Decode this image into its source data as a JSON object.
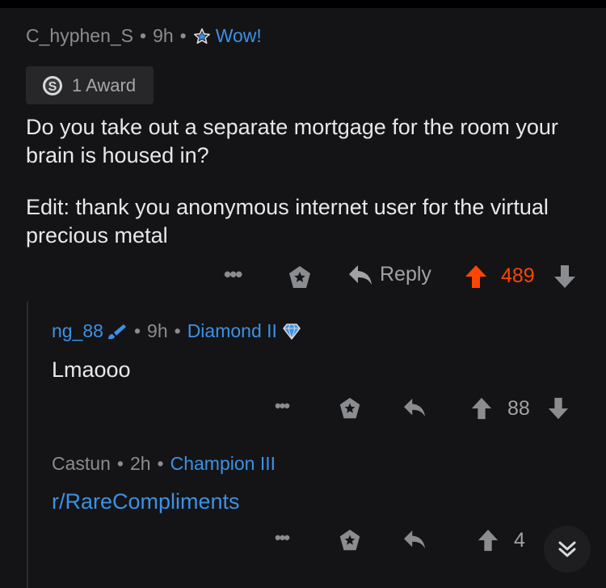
{
  "comments": [
    {
      "author": "C_hyphen_S",
      "time": "9h",
      "flair": "Wow!",
      "award": "1 Award",
      "body": [
        "Do you take out a separate mortgage for the room your brain is housed in?",
        "Edit: thank you anonymous internet user for the virtual precious metal"
      ],
      "reply_label": "Reply",
      "score": "489",
      "upvoted": true
    },
    {
      "author": "ng_88",
      "time": "9h",
      "flair": "Diamond II",
      "body": "Lmaooo",
      "score": "88"
    },
    {
      "author": "Castun",
      "time": "2h",
      "flair": "Champion III",
      "body": "r/RareCompliments",
      "score": "4"
    }
  ],
  "separator": "•",
  "colors": {
    "background": "#141416",
    "flair": "#3c91e6",
    "upvote": "#ff4500",
    "muted": "#8a8c90"
  },
  "icons": [
    "star-badge-icon",
    "silver-coin-icon",
    "more-options-icon",
    "award-icon",
    "reply-icon",
    "upvote-icon",
    "downvote-icon",
    "paintbrush-icon",
    "diamond-icon",
    "collapse-chevrons-icon"
  ]
}
